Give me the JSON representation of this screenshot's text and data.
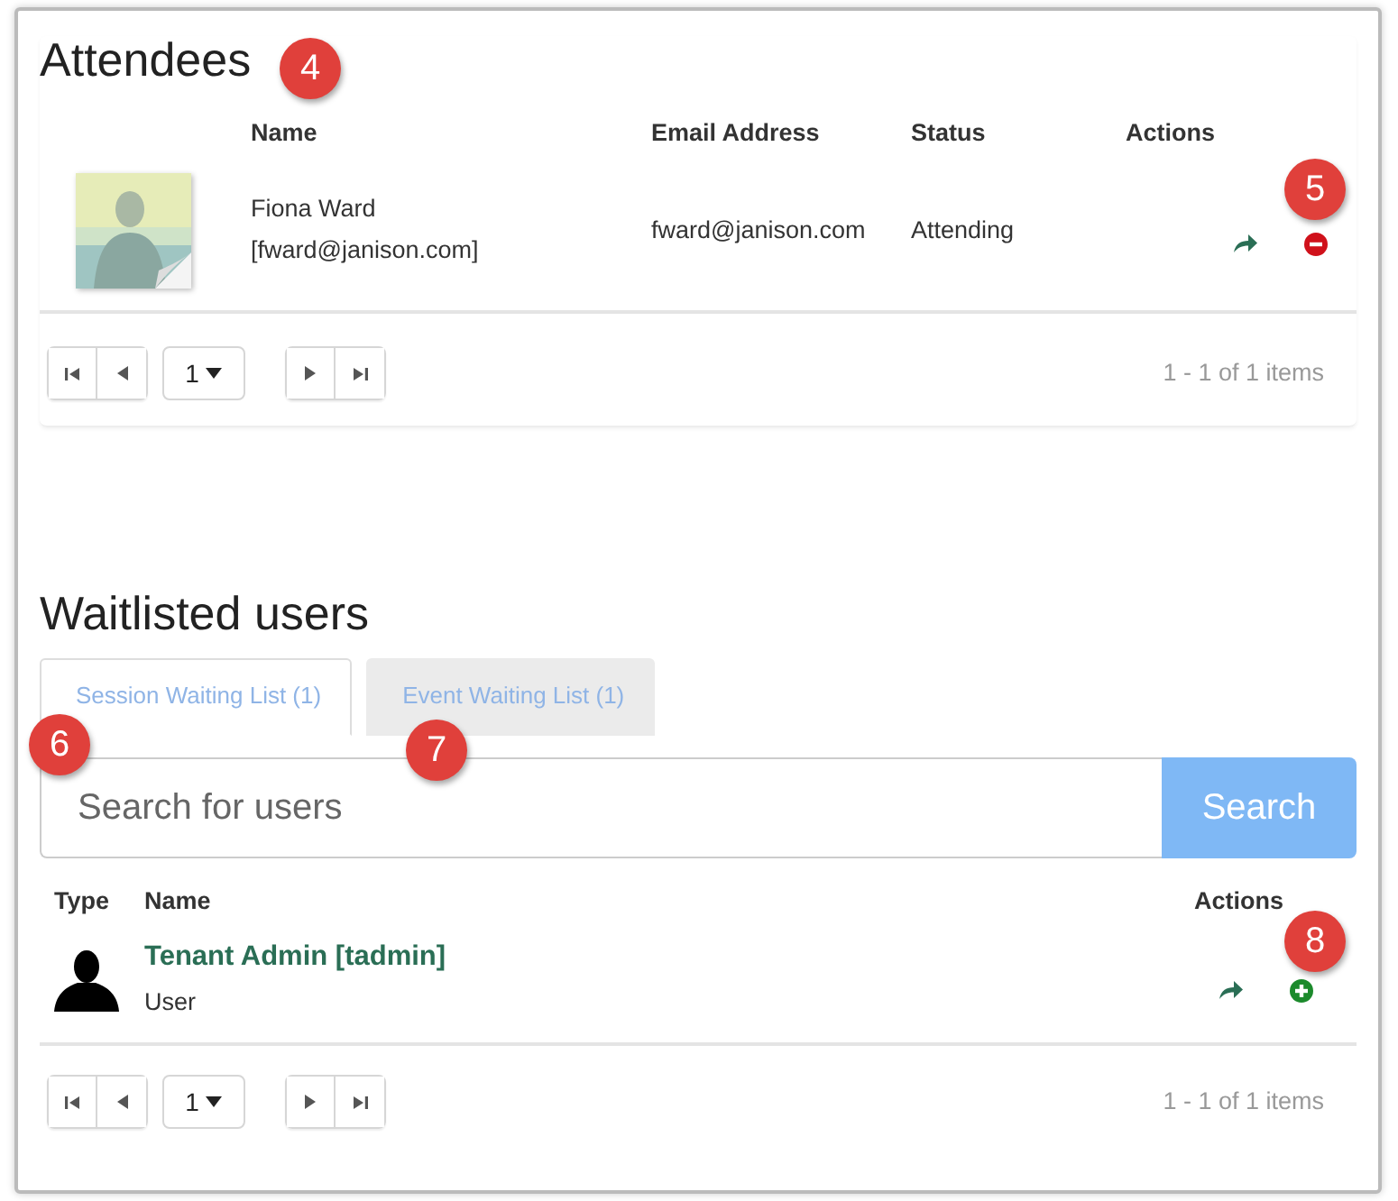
{
  "attendees": {
    "title": "Attendees",
    "columns": [
      "Name",
      "Email Address",
      "Status",
      "Actions"
    ],
    "rows": [
      {
        "kind": "picture",
        "name": "Fiona Ward",
        "username": "[fward@janison.com]",
        "email": "fward@janison.com",
        "status": "Attending",
        "actions": [
          {
            "kind": "share"
          },
          {
            "kind": "remove"
          }
        ]
      }
    ],
    "pager": {
      "page": "1",
      "info": "1 - 1 of 1 items"
    }
  },
  "waitlist": {
    "title": "Waitlisted users",
    "tabs": [
      {
        "label": "Session Waiting List (1)",
        "selected": true
      },
      {
        "label": "Event Waiting List (1)",
        "selected": false
      }
    ],
    "search": {
      "placeholder": "Search for users",
      "button": "Search"
    },
    "columns": [
      "Type",
      "Name",
      "Actions"
    ],
    "rows": [
      {
        "kind": "silhouette",
        "name": "Tenant Admin [tadmin]",
        "type_label": "User",
        "actions": [
          {
            "kind": "share"
          },
          {
            "kind": "add"
          }
        ]
      }
    ],
    "pager": {
      "page": "1",
      "info": "1 - 1 of 1 items"
    }
  },
  "callouts": [
    {
      "text": "4"
    },
    {
      "text": "5"
    },
    {
      "text": "6"
    },
    {
      "text": "7"
    },
    {
      "text": "8"
    }
  ]
}
